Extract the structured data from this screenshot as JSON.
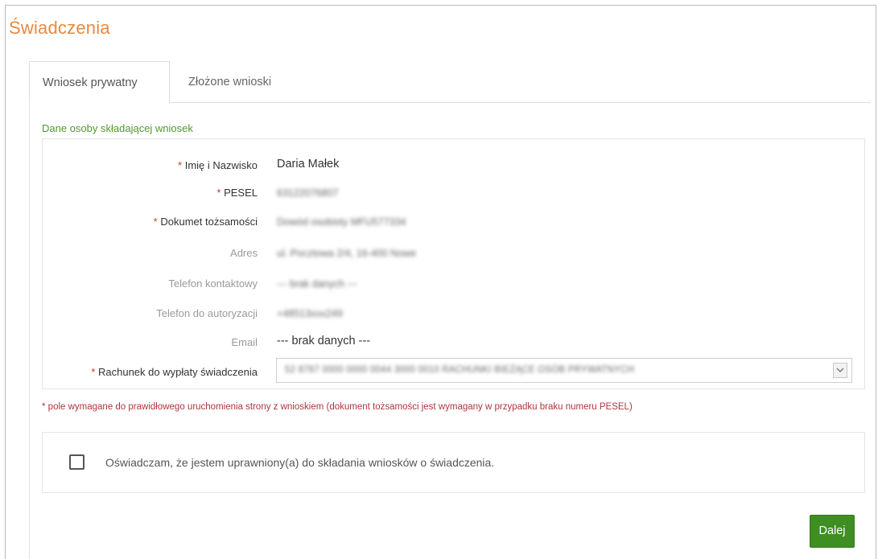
{
  "page": {
    "title": "Świadczenia"
  },
  "tabs": [
    {
      "label": "Wniosek prywatny",
      "active": true
    },
    {
      "label": "Złożone wnioski",
      "active": false
    }
  ],
  "applicant_section": {
    "title": "Dane osoby składającej wniosek",
    "fields": {
      "name": {
        "required_mark": "*",
        "label": "Imię i Nazwisko",
        "value": "Daria Małek"
      },
      "pesel": {
        "required_mark": "*",
        "label": "PESEL",
        "value": "63122076807"
      },
      "id_document": {
        "required_mark": "*",
        "label": "Dokumet tożsamości",
        "value": "Dowód osobisty MFU577334"
      },
      "address": {
        "label": "Adres",
        "value": "ul. Pocztowa 2/4, 16-400 Nowe"
      },
      "contact_phone": {
        "label": "Telefon kontaktowy",
        "value": "--- brak danych ---"
      },
      "auth_phone": {
        "label": "Telefon do autoryzacji",
        "value": "+48513xxx249"
      },
      "email": {
        "label": "Email",
        "value": "--- brak danych ---"
      },
      "account": {
        "required_mark": "*",
        "label": "Rachunek do wypłaty świadczenia",
        "selected": "52 8787 0000 0000 0044 3000 0010 RACHUNKI BIEŻĄCE OSÓB PRYWATNYCH"
      }
    }
  },
  "required_note": "* pole wymagane do prawidłowego uruchomienia strony z wnioskiem (dokument tożsamości jest wymagany w przypadku braku numeru PESEL)",
  "declaration": {
    "checked": false,
    "text": "Oświadczam, że jestem uprawniony(a) do składania wniosków o świadczenia."
  },
  "actions": {
    "next_label": "Dalej"
  },
  "colors": {
    "title_orange": "#e8893f",
    "section_green": "#4f9a2e",
    "button_green": "#3f8e22",
    "required_red": "#b0343f"
  }
}
